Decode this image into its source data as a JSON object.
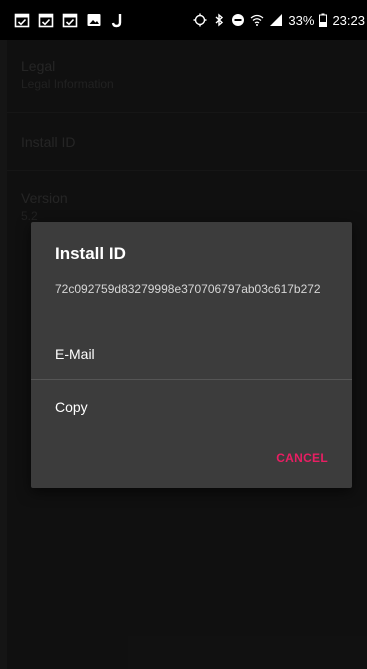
{
  "status_bar": {
    "left_icons": [
      "calendar-check-icon",
      "calendar-check-icon",
      "calendar-check-icon",
      "image-icon",
      "j-app-icon"
    ],
    "right_icons": [
      "location-icon",
      "bluetooth-icon",
      "do-not-disturb-icon",
      "wifi-icon",
      "signal-icon"
    ],
    "battery_text": "33%",
    "time": "23:23"
  },
  "settings": {
    "items": [
      {
        "title": "Legal",
        "summary": "Legal Information"
      },
      {
        "title": "Install ID",
        "summary": ""
      },
      {
        "title": "Version",
        "summary": "5.2"
      }
    ]
  },
  "dialog": {
    "title": "Install ID",
    "message": "72c092759d83279998e370706797ab03c617b272",
    "items": [
      "E-Mail",
      "Copy"
    ],
    "cancel_label": "CANCEL"
  },
  "colors": {
    "accent": "#e91e63",
    "dialog_bg": "#3c3c3c",
    "screen_bg": "#1a1a1a"
  }
}
